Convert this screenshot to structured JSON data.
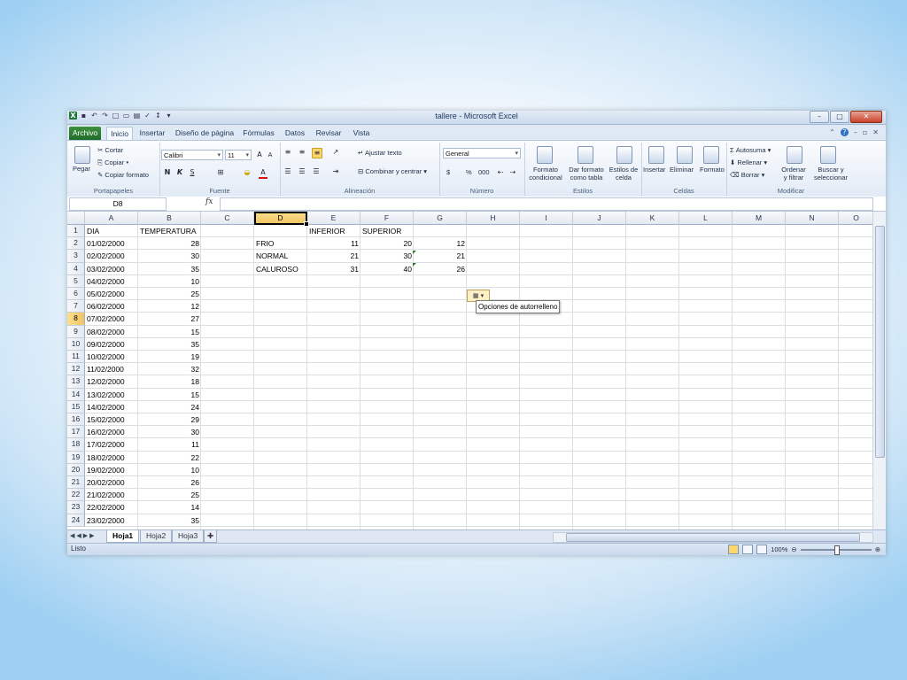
{
  "window": {
    "title": "tallere - Microsoft Excel"
  },
  "tabs": [
    "Archivo",
    "Inicio",
    "Insertar",
    "Diseño de página",
    "Fórmulas",
    "Datos",
    "Revisar",
    "Vista"
  ],
  "ribbon": {
    "portapapeles": {
      "paste": "Pegar",
      "cut": "Cortar",
      "copy": "Copiar",
      "format_painter": "Copiar formato",
      "label": "Portapapeles"
    },
    "fuente": {
      "font": "Calibri",
      "size": "11",
      "bold": "N",
      "italic": "K",
      "underline": "S",
      "label": "Fuente"
    },
    "alineacion": {
      "wrap": "Ajustar texto",
      "merge": "Combinar y centrar",
      "label": "Alineación"
    },
    "numero": {
      "format": "General",
      "currency": "$",
      "percent": "%",
      "thousands": "000",
      "label": "Número"
    },
    "estilos": {
      "conditional_1": "Formato",
      "conditional_2": "condicional",
      "table_1": "Dar formato",
      "table_2": "como tabla",
      "cell_1": "Estilos de",
      "cell_2": "celda",
      "label": "Estilos"
    },
    "celdas": {
      "insert": "Insertar",
      "delete": "Eliminar",
      "format": "Formato",
      "label": "Celdas"
    },
    "modificar": {
      "autosum": "Autosuma",
      "fill": "Rellenar",
      "clear": "Borrar",
      "sort_1": "Ordenar",
      "sort_2": "y filtrar",
      "find_1": "Buscar y",
      "find_2": "seleccionar",
      "label": "Modificar"
    }
  },
  "formula_bar": {
    "name_box": "D8",
    "fx": "fx",
    "value": ""
  },
  "columns": [
    "A",
    "B",
    "C",
    "D",
    "E",
    "F",
    "G",
    "H",
    "I",
    "J",
    "K",
    "L",
    "M",
    "N",
    "O"
  ],
  "rows": [
    {
      "n": "1",
      "A": "DIA",
      "B": "TEMPERATURA",
      "D": "",
      "E": "INFERIOR",
      "F": "SUPERIOR",
      "G": ""
    },
    {
      "n": "2",
      "A": "01/02/2000",
      "B": "28",
      "D": "FRIO",
      "E": "11",
      "F": "20",
      "G": "12"
    },
    {
      "n": "3",
      "A": "02/02/2000",
      "B": "30",
      "D": "NORMAL",
      "E": "21",
      "F": "30",
      "G": "21"
    },
    {
      "n": "4",
      "A": "03/02/2000",
      "B": "35",
      "D": "CALUROSO",
      "E": "31",
      "F": "40",
      "G": "26"
    },
    {
      "n": "5",
      "A": "04/02/2000",
      "B": "10"
    },
    {
      "n": "6",
      "A": "05/02/2000",
      "B": "25"
    },
    {
      "n": "7",
      "A": "06/02/2000",
      "B": "12"
    },
    {
      "n": "8",
      "A": "07/02/2000",
      "B": "27"
    },
    {
      "n": "9",
      "A": "08/02/2000",
      "B": "15"
    },
    {
      "n": "10",
      "A": "09/02/2000",
      "B": "35"
    },
    {
      "n": "11",
      "A": "10/02/2000",
      "B": "19"
    },
    {
      "n": "12",
      "A": "11/02/2000",
      "B": "32"
    },
    {
      "n": "13",
      "A": "12/02/2000",
      "B": "18"
    },
    {
      "n": "14",
      "A": "13/02/2000",
      "B": "15"
    },
    {
      "n": "15",
      "A": "14/02/2000",
      "B": "24"
    },
    {
      "n": "16",
      "A": "15/02/2000",
      "B": "29"
    },
    {
      "n": "17",
      "A": "16/02/2000",
      "B": "30"
    },
    {
      "n": "18",
      "A": "17/02/2000",
      "B": "11"
    },
    {
      "n": "19",
      "A": "18/02/2000",
      "B": "22"
    },
    {
      "n": "20",
      "A": "19/02/2000",
      "B": "10"
    },
    {
      "n": "21",
      "A": "20/02/2000",
      "B": "26"
    },
    {
      "n": "22",
      "A": "21/02/2000",
      "B": "25"
    },
    {
      "n": "23",
      "A": "22/02/2000",
      "B": "14"
    },
    {
      "n": "24",
      "A": "23/02/2000",
      "B": "35"
    }
  ],
  "autofill_tooltip": "Opciones de autorrelleno",
  "sheets": [
    "Hoja1",
    "Hoja2",
    "Hoja3"
  ],
  "active_sheet": "Hoja1",
  "status": {
    "ready": "Listo",
    "zoom": "100%"
  },
  "colors": {
    "file_tab": "#1f6b2a",
    "selection_header": "#f2c461",
    "grid_line": "#dadfe6"
  }
}
